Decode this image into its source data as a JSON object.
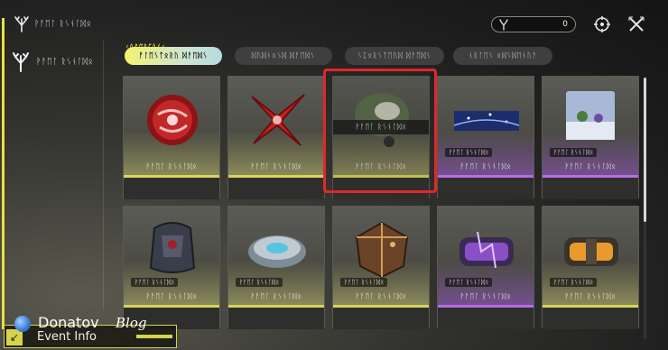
{
  "topbar": {
    "title": "ᚹᚨᛖᛚ ᚱᛊᚾᛚᛞᛟ",
    "currency_value": "0",
    "logo_icon": "coral-emblem-icon",
    "action_icons": [
      "settings-hex-icon",
      "close-x-icon"
    ]
  },
  "sidebar": {
    "items": [
      {
        "label": "ᚹᚨᛖᛚ ᚱᛊᚾᛚᛞᛟ",
        "icon": "coral-emblem-icon"
      }
    ]
  },
  "tabs": [
    {
      "label": "ᚠᛚᛖᛊᛏᛟᚱᚢ ᛞᚨᛖᛞᛊ",
      "sub": "ᚲᚢᛒᛖᚱᛈᚢᚾᚲ",
      "active": true
    },
    {
      "label": "ᛞᚢᛞᚾᛟᛊᛞ ᛞᚨᛖᛞᛊ",
      "active": false
    },
    {
      "label": "ᛊᛈᛟᚱᛊᛏᛖᚢᛞ ᛞᚨᛖᛞᛊ",
      "active": false
    },
    {
      "label": "ᚾᚱᛚᛖᛊ ᛟᛞᛊᛞᛖᚾᚢᚨ",
      "active": false
    }
  ],
  "grid": {
    "cards": [
      {
        "name": "ᚹᚨᛖᛚ ᚱᛊᚾᛚᛞᛟ",
        "rarity": "yellow",
        "art": "red-orb-icon"
      },
      {
        "name": "ᚹᚨᛖᛚ ᚱᛊᚾᛚᛞᛟ",
        "rarity": "yellow",
        "art": "red-shuriken-icon"
      },
      {
        "name": "ᚹᚨᛖᛚ ᚱᛊᚾᛚᛞᛟ",
        "rarity": "yellow",
        "art": "planet-orb-icon",
        "hover_label": "ᚹᚨᛖᛚ ᚱᛊᚾᛚᛞᛟ",
        "selected": true
      },
      {
        "name": "ᚹᚨᛖᛚ ᚱᛊᚾᛚᛞᛟ",
        "rarity": "purple",
        "art": "night-sky-banner-icon",
        "tag": "ᚹᚨᛖᛚ ᚱᛊᚾᛚᛞᛟ"
      },
      {
        "name": "ᚹᚨᛖᛚ ᚱᛊᚾᛚᛞᛟ",
        "rarity": "purple",
        "art": "winter-scene-card-icon",
        "tag": "ᚹᚨᛖᛚ ᚱᛊᚾᛚᛞᛟ"
      },
      {
        "name": "ᚹᚨᛖᛚ ᚱᛊᚾᛚᛞᛟ",
        "rarity": "yellow",
        "art": "armored-bag-icon",
        "tag": "ᚹᚨᛖᛚ ᚱᛊᚾᛚᛞᛟ"
      },
      {
        "name": "ᚹᚨᛖᛚ ᚱᛊᚾᛚᛞᛟ",
        "rarity": "yellow",
        "art": "tech-disc-icon",
        "tag": "ᚹᚨᛖᛚ ᚱᛊᚾᛚᛞᛟ"
      },
      {
        "name": "ᚹᚨᛖᛚ ᚱᛊᚾᛚᛞᛟ",
        "rarity": "yellow",
        "art": "bronze-crate-icon",
        "tag": "ᚹᚨᛖᛚ ᚱᛊᚾᛚᛞᛟ"
      },
      {
        "name": "ᚹᚨᛖᛚ ᚱᛊᚾᛚᛞᛟ",
        "rarity": "purple",
        "art": "purple-capsule-icon",
        "tag": "ᚹᚨᛖᛚ ᚱᛊᚾᛚᛞᛟ"
      },
      {
        "name": "ᚹᚨᛖᛚ ᚱᛊᚾᛚᛞᛟ",
        "rarity": "yellow",
        "art": "orange-capsule-icon",
        "tag": "ᚹᚨᛖᛚ ᚱᛊᚾᛚᛞᛟ"
      }
    ]
  },
  "event": {
    "label": "Event Info",
    "icon": "arrow-down-left-icon"
  },
  "watermark": {
    "name": "Donatov",
    "suffix": "Blog"
  },
  "colors": {
    "accent_yellow": "#e8e23e",
    "rarity_purple": "#b96be6",
    "selection_red": "#e3262a"
  }
}
